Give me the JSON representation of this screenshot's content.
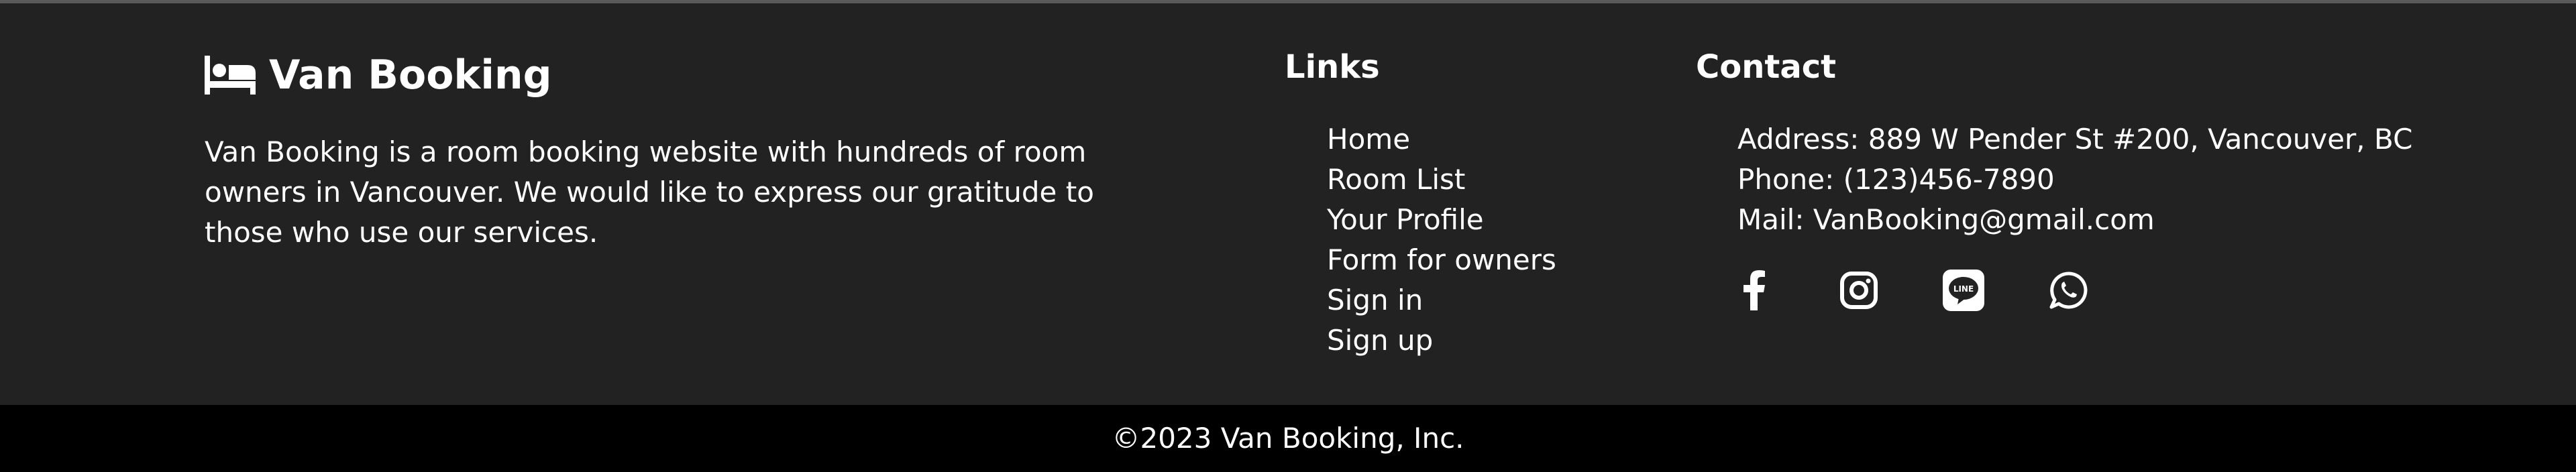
{
  "brand": {
    "icon": "bed-icon",
    "title": "Van Booking",
    "description": "Van Booking is a room booking website with hundreds of room owners in Vancouver. We would like to express our gratitude to those who use our services."
  },
  "links": {
    "heading": "Links",
    "items": [
      {
        "label": "Home"
      },
      {
        "label": "Room List"
      },
      {
        "label": "Your Profile"
      },
      {
        "label": "Form for owners"
      },
      {
        "label": "Sign in"
      },
      {
        "label": "Sign up"
      }
    ]
  },
  "contact": {
    "heading": "Contact",
    "address": "Address: 889 W Pender St #200, Vancouver, BC",
    "phone": "Phone: (123)456-7890",
    "mail": "Mail: VanBooking@gmail.com",
    "social": [
      {
        "icon": "facebook-icon"
      },
      {
        "icon": "instagram-icon"
      },
      {
        "icon": "line-icon",
        "text": "LINE"
      },
      {
        "icon": "whatsapp-icon"
      }
    ]
  },
  "footer": {
    "copyright": "©2023 Van Booking, Inc."
  },
  "colors": {
    "footer_bg": "#222222",
    "copyright_bg": "#000000",
    "text": "#ffffff"
  }
}
